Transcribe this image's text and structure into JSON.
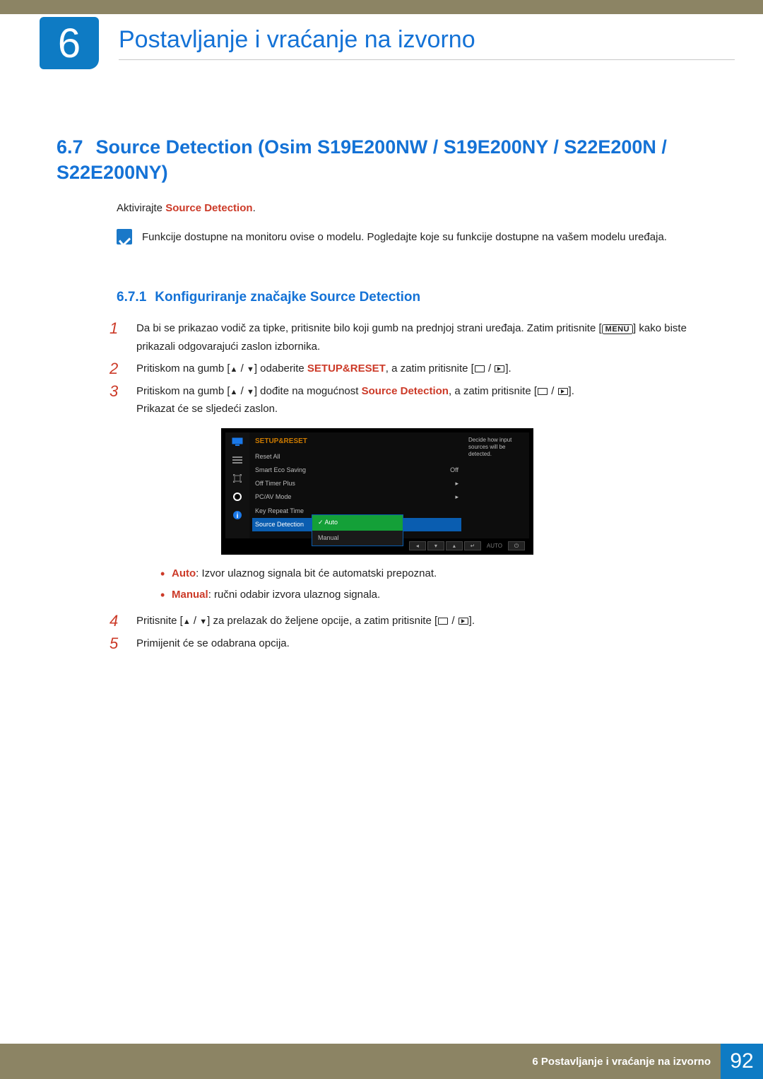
{
  "chapter": {
    "number": "6",
    "title": "Postavljanje i vraćanje na izvorno"
  },
  "section": {
    "number": "6.7",
    "title": "Source Detection (Osim S19E200NW / S19E200NY / S22E200N / S22E200NY)"
  },
  "intro": {
    "prefix": "Aktivirajte ",
    "highlight": "Source Detection",
    "suffix": "."
  },
  "note": "Funkcije dostupne na monitoru ovise o modelu. Pogledajte koje su funkcije dostupne na vašem modelu uređaja.",
  "subsection": {
    "number": "6.7.1",
    "title": "Konfiguriranje značajke Source Detection"
  },
  "steps": {
    "s1": {
      "line1": "Da bi se prikazao vodič za tipke, pritisnite bilo koji gumb na prednjoj strani uređaja. Zatim pritisnite",
      "menu": "MENU",
      "line2": "kako biste prikazali odgovarajući zaslon izbornika."
    },
    "s2": {
      "pre": "Pritiskom na gumb [",
      "mid": "] odaberite ",
      "hl": "SETUP&RESET",
      "post": ", a zatim pritisnite [",
      "end": "]."
    },
    "s3": {
      "pre": "Pritiskom na gumb [",
      "mid": "] dođite na mogućnost ",
      "hl": "Source Detection",
      "post": ", a zatim pritisnite [",
      "end": "].",
      "after": "Prikazat će se sljedeći zaslon."
    },
    "s4": {
      "pre": "Pritisnite [",
      "mid": "] za prelazak do željene opcije, a zatim pritisnite [",
      "end": "]."
    },
    "s5": "Primijenit će se odabrana opcija."
  },
  "bullets": {
    "auto_label": "Auto",
    "auto_text": ": Izvor ulaznog signala bit će automatski prepoznat.",
    "manual_label": "Manual",
    "manual_text": ": ručni odabir izvora ulaznog signala."
  },
  "osd": {
    "title": "SETUP&RESET",
    "items": [
      {
        "label": "Reset All",
        "value": ""
      },
      {
        "label": "Smart Eco Saving",
        "value": "Off"
      },
      {
        "label": "Off Timer Plus",
        "value": "▸"
      },
      {
        "label": "PC/AV Mode",
        "value": "▸"
      },
      {
        "label": "Key Repeat Time",
        "value": ""
      },
      {
        "label": "Source Detection",
        "value": ""
      }
    ],
    "submenu": {
      "opt1": "Auto",
      "opt2": "Manual"
    },
    "help": "Decide how input sources will be detected.",
    "footer_auto": "AUTO"
  },
  "footer": {
    "text": "6 Postavljanje i vraćanje na izvorno",
    "page": "92"
  }
}
